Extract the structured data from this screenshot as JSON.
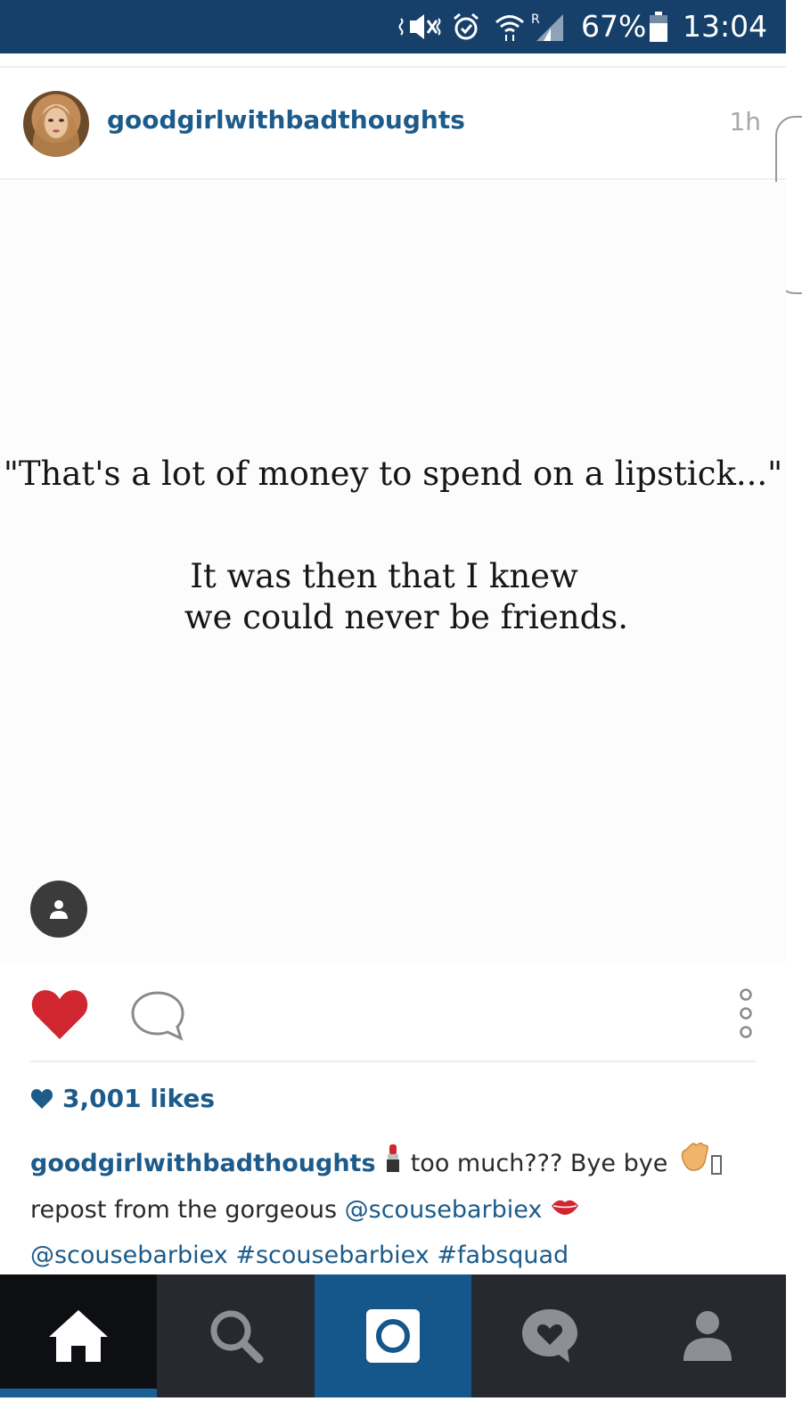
{
  "status_bar": {
    "battery": "67%",
    "time": "13:04",
    "icons": [
      "mute-icon",
      "alarm-icon",
      "wifi-icon",
      "signal-roaming-icon",
      "battery-icon"
    ]
  },
  "post": {
    "username": "goodgirlwithbadthoughts",
    "time_ago": "1h",
    "image_quote_line1": "\"That's a lot of money to spend on a lipstick...\"",
    "image_quote_line2": "It was then that I knew",
    "image_quote_line3": "we could never be friends.",
    "likes": "3,001 likes",
    "caption": {
      "user": "goodgirlwithbadthoughts",
      "text1": " too much??? Bye bye ",
      "text2": "repost from the gorgeous ",
      "mention1": "@scousebarbiex",
      "mention2": "@scousebarbiex",
      "hashtag1": "#scousebarbiex",
      "hashtag2": "#fabsquad"
    }
  },
  "nav": [
    "home-icon",
    "search-icon",
    "camera-icon",
    "activity-icon",
    "profile-icon"
  ],
  "colors": {
    "status_bar": "#164069",
    "link": "#1c5b8a",
    "heart": "#d0262f",
    "nav_bg": "#262a30",
    "nav_active": "#15578b"
  }
}
